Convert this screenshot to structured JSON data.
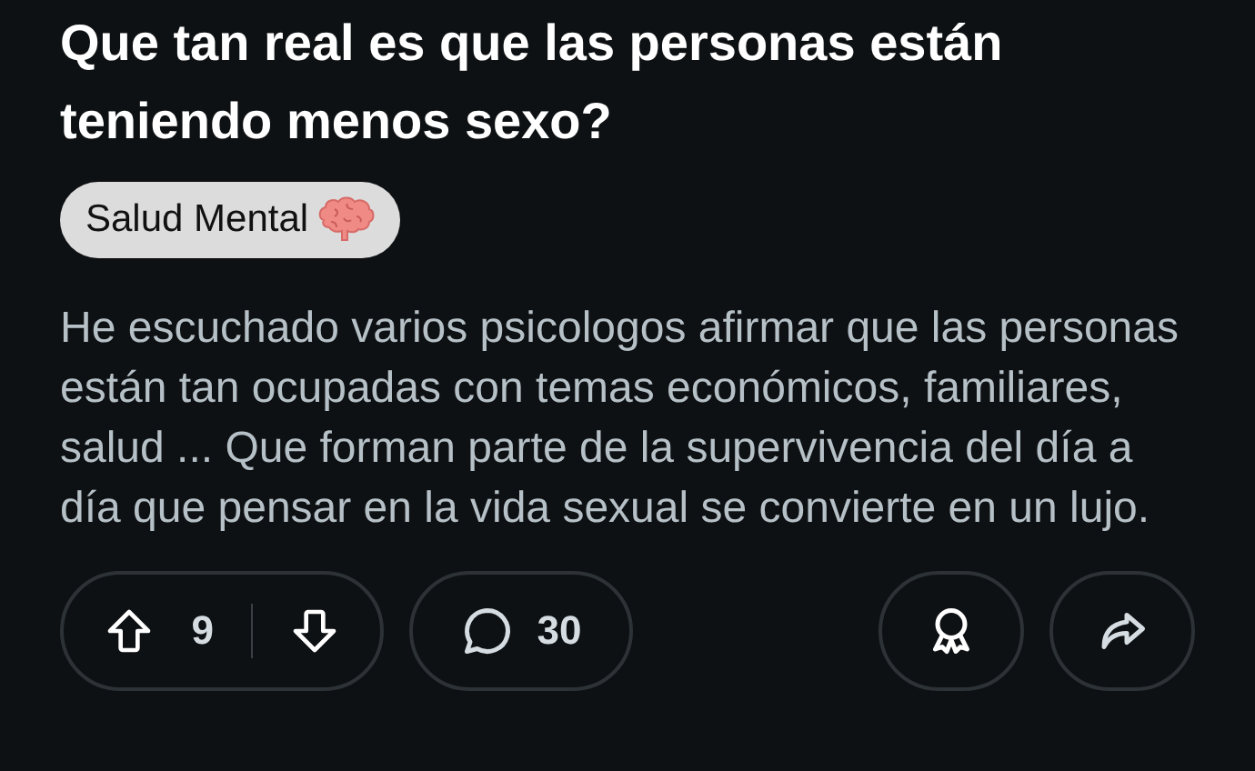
{
  "post": {
    "title": "Que tan real es que las personas están teniendo menos sexo?",
    "flair": {
      "label": "Salud Mental"
    },
    "body": "He escuchado varios psicologos afirmar que las personas están tan ocupadas con temas económicos, familiares, salud ... Que forman parte de la supervivencia del día a día que pensar en la vida sexual se convierte en un lujo.",
    "score": "9",
    "comments": "30"
  }
}
